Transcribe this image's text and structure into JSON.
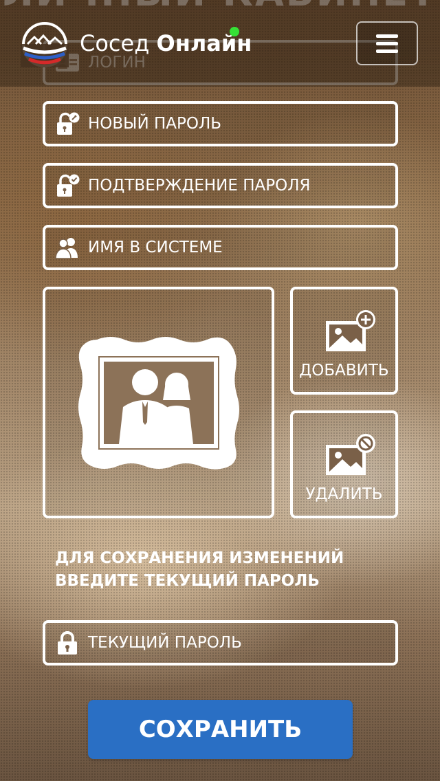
{
  "page": {
    "ghost_title": "ЛИЧНЫЙ КАБИНЕТ"
  },
  "header": {
    "brand_first": "Сосед",
    "brand_second": "Онлайн",
    "status_color": "#35e035",
    "menu_icon": "hamburger-icon"
  },
  "form": {
    "login": {
      "label": "ЛОГИН",
      "icon": "id-card-icon"
    },
    "new_password": {
      "label": "НОВЫЙ ПАРОЛЬ",
      "icon": "lock-key-icon"
    },
    "confirm_password": {
      "label": "ПОДТВЕРЖДЕНИЕ ПАРОЛЯ",
      "icon": "lock-check-icon"
    },
    "display_name": {
      "label": "ИМЯ В СИСТЕМЕ",
      "icon": "users-icon"
    }
  },
  "avatar": {
    "icon": "framed-couple-icon",
    "add_label": "ДОБАВИТЬ",
    "add_icon": "image-add-icon",
    "delete_label": "УДАЛИТЬ",
    "delete_icon": "image-remove-icon"
  },
  "note": "ДЛЯ СОХРАНЕНИЯ ИЗМЕНЕНИЙ ВВЕДИТЕ ТЕКУЩИЙ ПАРОЛЬ",
  "current_password": {
    "label": "ТЕКУЩИЙ ПАРОЛЬ",
    "icon": "lock-icon"
  },
  "save_button": {
    "label": "СОХРАНИТЬ",
    "color": "#2a6fc4"
  }
}
